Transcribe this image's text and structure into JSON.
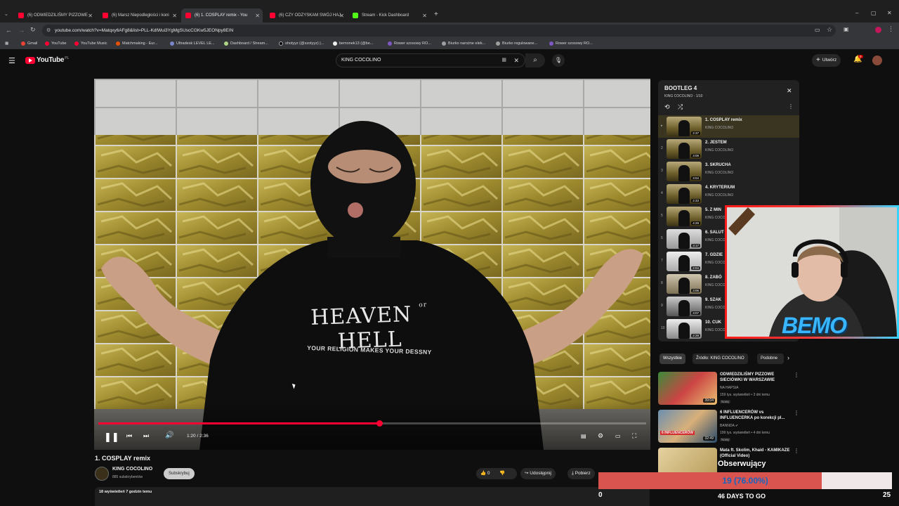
{
  "browser": {
    "tabs": [
      {
        "label": "(6) ODWIEDZILIŚMY PIZZOWE"
      },
      {
        "label": "(6) Marsz Niepodległości i koni"
      },
      {
        "label": "(6) 1. COSPLAY remix - You"
      },
      {
        "label": "(6) CZY ODZYSKAM SWÓJ HAJ"
      },
      {
        "label": "Stream - Kick Dashboard"
      }
    ],
    "url": "youtube.com/watch?v=Matqxy6AFg8&list=PLL-KdlWui3YgMgSUscCGKw5JEONpy8EIN",
    "bookmarks": [
      {
        "label": "Gmail"
      },
      {
        "label": "YouTube"
      },
      {
        "label": "YouTube Music"
      },
      {
        "label": "Matchmaking - Eur..."
      },
      {
        "label": "Ultradesk LEVEL LE..."
      },
      {
        "label": "Dashboard / Stream..."
      },
      {
        "label": "shotyyz (@szotyyz) |..."
      },
      {
        "label": "bemonek13 (@be..."
      },
      {
        "label": "Rower szosowy RO..."
      },
      {
        "label": "Biurko narożne elek..."
      },
      {
        "label": "Biurko regulowane..."
      },
      {
        "label": "Rower szosowy RO..."
      }
    ],
    "colors": {
      "accent": "#ff0033"
    }
  },
  "youtube": {
    "logo": "YouTube",
    "logo_region": "PL",
    "search_value": "KING COCOLINO",
    "create_label": "Utwórz",
    "notif_count": "9"
  },
  "player": {
    "time": "1:20 / 2:36",
    "progress": 0.513,
    "shirt_line1": "HEAVEN",
    "shirt_small": "or",
    "shirt_line2": "HELL",
    "shirt_line3": "YOUR RELIGION MAKES YOUR DESSNY"
  },
  "video": {
    "title": "1. COSPLAY remix",
    "channel": "KING COCOLINO",
    "subs": "885 subskrybentów",
    "subscribe": "Subskrybuj",
    "likes": "0",
    "share": "Udostępnij",
    "download": "Pobierz",
    "views_time": "18 wyświetleń  7 godzin temu"
  },
  "playlist": {
    "title": "BOOTLEG 4",
    "subtitle": "KING COCOLINO - 1/10",
    "items": [
      {
        "num": "▸",
        "title": "1. COSPLAY remix",
        "channel": "KING COCOLINO",
        "duration": "2:37"
      },
      {
        "num": "2",
        "title": "2. JESTEM",
        "channel": "KING COCOLINO",
        "duration": "3:08"
      },
      {
        "num": "3",
        "title": "3. SKRUCHA",
        "channel": "KING COCOLINO",
        "duration": "3:04"
      },
      {
        "num": "4",
        "title": "4. KRYTERIUM",
        "channel": "KING COCOLINO",
        "duration": "2:33"
      },
      {
        "num": "5",
        "title": "5. Z MIN",
        "channel": "KING COCOLINO",
        "duration": "4:29"
      },
      {
        "num": "5",
        "title": "6. SALUT",
        "channel": "KING COCO",
        "duration": "3:17"
      },
      {
        "num": "7",
        "title": "7. GDZIE",
        "channel": "KING COCO",
        "duration": "2:04"
      },
      {
        "num": "8",
        "title": "8. ZABÓ",
        "channel": "KING COCO",
        "duration": "3:06"
      },
      {
        "num": "9",
        "title": "9. SZAK",
        "channel": "KING COCO",
        "duration": "3:07"
      },
      {
        "num": "10",
        "title": "10. CUK",
        "channel": "KING COCO",
        "duration": "2:28"
      }
    ]
  },
  "chips": [
    {
      "label": "Wszystkie"
    },
    {
      "label": "Źródło: KING COCOLINO"
    },
    {
      "label": "Podobne"
    }
  ],
  "recommendations": [
    {
      "title": "ODWIEDZILIŚMY PIZZOWE SIECIÓWKI W WARSZAWIE",
      "channel": "NA HAPSIA",
      "meta": "159 tys. wyświetleń • 3 dni temu",
      "badge": "Nowy",
      "duration": "39:04"
    },
    {
      "title": "6 INFLUENCERÓW vs INFLUENCERKA po korekcji pl...",
      "channel": "BANNDA",
      "meta": "199 tys. wyświetleń • 4 dni temu",
      "badge": "Nowy",
      "duration": "32:49",
      "thumb_text": "6 INFLUENCERÓW"
    },
    {
      "title": "Mata ft. Skolim, Khaid - KAMIKAZE (Official Video)",
      "channel": "",
      "meta": "",
      "badge": "",
      "duration": ""
    }
  ],
  "overlay": {
    "streamer_name": "BEMO",
    "follow_label": "Obserwujący",
    "goal_text": "19 (76.00%)",
    "goal_progress": 0.76,
    "goal_min": "0",
    "goal_max": "25",
    "days_left": "46 DAYS TO GO"
  }
}
